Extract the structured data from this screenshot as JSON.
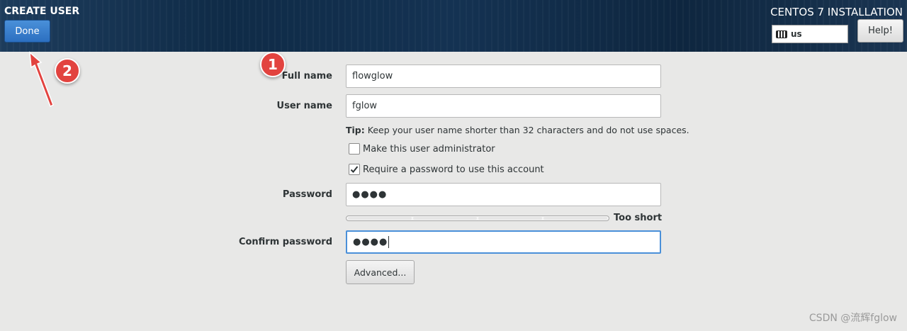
{
  "header": {
    "title": "CREATE USER",
    "done_label": "Done",
    "install_title": "CENTOS 7 INSTALLATION",
    "keyboard_layout": "us",
    "help_label": "Help!"
  },
  "form": {
    "full_name_label": "Full name",
    "full_name_value": "flowglow",
    "user_name_label": "User name",
    "user_name_value": "fglow",
    "tip_prefix": "Tip:",
    "tip_text": " Keep your user name shorter than 32 characters and do not use spaces.",
    "admin_checkbox_label": "Make this user administrator",
    "admin_checked": false,
    "require_password_label": "Require a password to use this account",
    "require_password_checked": true,
    "password_label": "Password",
    "password_value": "●●●●",
    "strength_label": "Too short",
    "strength_level": 0,
    "confirm_label": "Confirm password",
    "confirm_value": "●●●●",
    "advanced_label": "Advanced..."
  },
  "annotations": {
    "badge_1": "1",
    "badge_2": "2",
    "arrow_color": "#e2433f"
  },
  "watermark": "CSDN @流辉fglow",
  "colors": {
    "accent": "#4a90d9",
    "header_bg": "#0f2b47",
    "badge": "#e2433f"
  }
}
